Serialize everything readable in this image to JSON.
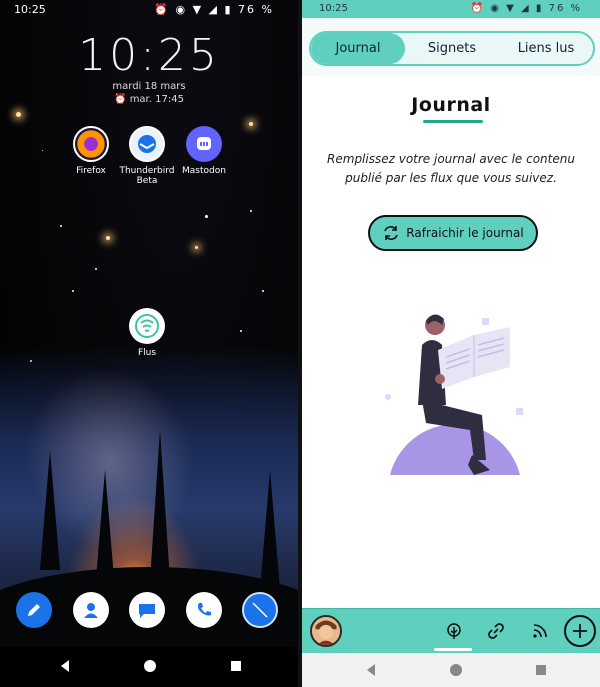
{
  "left": {
    "status": {
      "time": "10:25",
      "battery": "76 %"
    },
    "lockclock": {
      "time": "10:25",
      "date": "mardi 18 mars",
      "alarm": "mar. 17:45"
    },
    "apps": [
      {
        "label": "Firefox"
      },
      {
        "label": "Thunderbird Beta"
      },
      {
        "label": "Mastodon"
      },
      {
        "label": "Flus"
      }
    ],
    "dock": [
      "pencil-icon",
      "contacts-icon",
      "messages-icon",
      "phone-icon",
      "compass-icon"
    ]
  },
  "right": {
    "status": {
      "time": "10:25",
      "battery": "76 %"
    },
    "tabs": [
      {
        "label": "Journal",
        "active": true
      },
      {
        "label": "Signets",
        "active": false
      },
      {
        "label": "Liens lus",
        "active": false
      }
    ],
    "title": "Journal",
    "intro": "Remplissez votre journal avec le contenu publié par les flux que vous suivez.",
    "refresh_label": "Rafraichir le journal",
    "accent": "#5fd0bd",
    "illustration_color": "#a895e6"
  }
}
